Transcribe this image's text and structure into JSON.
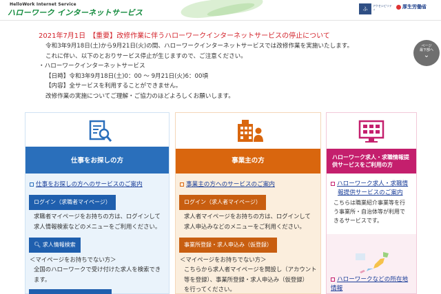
{
  "header": {
    "logo_sub": "HelloWork Internet Service",
    "logo_main": "ハローワーク インターネットサービス",
    "icon1_label": "ふ",
    "icon2_label": "アクセシビリティ",
    "ministry": "厚生労働省"
  },
  "notice": {
    "title": "2021年7月1日　【重要】改修作業に伴うハローワークインターネットサービスの停止について",
    "line1": "令和3年9月18日(土)から9月21日(火)の間、ハローワークインターネットサービスでは改修作業を実施いたします。",
    "line2": "これに伴い、以下のとおりサービス停止が生じますので、ご注意ください。",
    "line3": "・ハローワークインターネットサービス",
    "line4": "【日時】令和3年9月18日(土)0：00 ～ 9月21日(火)6：00頃",
    "line5": "【内容】全サービスを利用することができません。",
    "line6": "改修作業の実施についてご理解・ご協力のほどよろしくお願いします。"
  },
  "scroll_button": {
    "line1": "ページ",
    "line2": "最下部へ"
  },
  "col1": {
    "band": "仕事をお探しの方",
    "link": "仕事をお探しの方へのサービスのご案内",
    "button1": "ログイン（求職者マイページ）",
    "text1a": "求職者マイページをお持ちの方は、ログインして",
    "text1b": "求人情報検索などのメニューをご利用ください。",
    "button2": "求人情報検索",
    "text2a": "＜マイページをお持ちでない方＞",
    "text2b": "全国のハローワークで受け付けた求人を検索でき",
    "text2c": "ます。"
  },
  "col2": {
    "band": "事業主の方",
    "link": "事業主の方へのサービスのご案内",
    "button1": "ログイン（求人者マイページ）",
    "text1a": "求人者マイページをお持ちの方は、ログインして",
    "text1b": "求人申込みなどのメニューをご利用ください。",
    "button2": "事業所登録・求人申込み（仮登録）",
    "text2a": "＜マイページをお持ちでない方＞",
    "text2b": "こちらから求人者マイページを開設し（アカウント",
    "text2c": "等を登録）、事業所登録・求人申込み（仮登録）",
    "text2d": "を行ってください。"
  },
  "col3": {
    "band_line1": "ハローワーク求人・求職情報提",
    "band_line2": "供サービスをご利用の方",
    "link_a": "ハローワーク求人・求職情",
    "link_b": "報提供サービスのご案内",
    "text_a": "こちらは職業紹介事業等を行",
    "text_b": "う事業所・自治体等が利用で",
    "text_c": "きるサービスです。",
    "link2_a": "ハローワークなどの所在地",
    "link2_b": "情報"
  },
  "colors": {
    "blue": "#2a6fbb",
    "orange": "#d9660e",
    "magenta": "#c41f6d",
    "notice_red": "#d3232b",
    "logo_green": "#128a3c"
  }
}
